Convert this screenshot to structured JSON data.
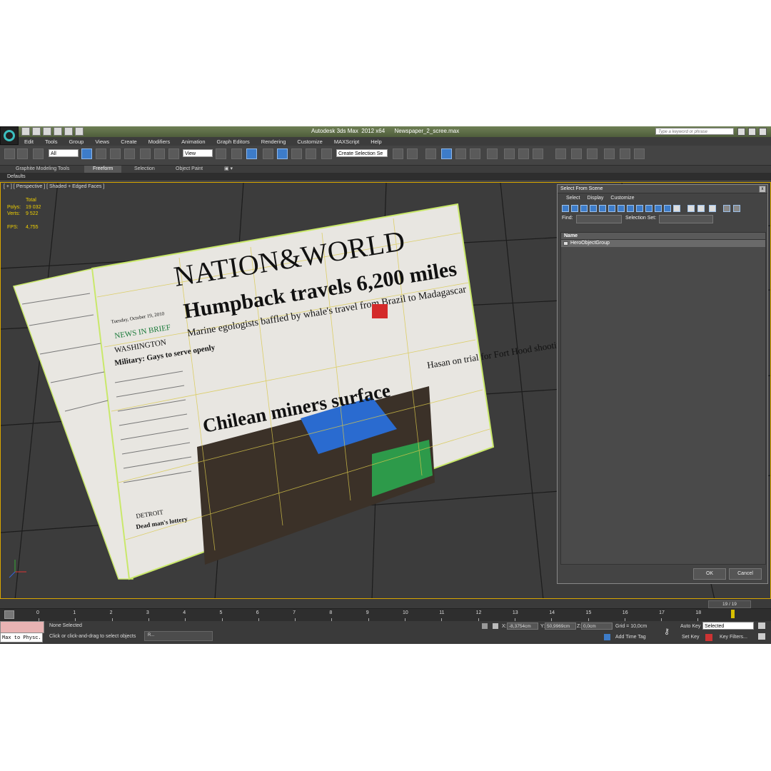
{
  "window": {
    "title": "Autodesk 3ds Max  2012 x64      Newspaper_2_scree.max",
    "search_placeholder": "Type a keyword or phrase"
  },
  "menu": [
    "Edit",
    "Tools",
    "Group",
    "Views",
    "Create",
    "Modifiers",
    "Animation",
    "Graph Editors",
    "Rendering",
    "Customize",
    "MAXScript",
    "Help"
  ],
  "toolbar": {
    "filter_value": "All",
    "ref_coord_value": "View",
    "selection_set_value": "Create Selection Se"
  },
  "ribbon": {
    "tabs": [
      "Graphite Modeling Tools",
      "Freeform",
      "Selection",
      "Object Paint"
    ],
    "active_tab": "Freeform",
    "defaults_label": "Defaults"
  },
  "viewport": {
    "label": "[ + ] [ Perspective ] [ Shaded + Edged Faces ]",
    "stats": {
      "total_label": "Total",
      "polys_label": "Polys:",
      "polys_value": "19 032",
      "verts_label": "Verts:",
      "verts_value": "9 522",
      "fps_label": "FPS:",
      "fps_value": "4,755"
    }
  },
  "newspaper": {
    "masthead": "NATION&WORLD",
    "headline": "Humpback travels 6,200 miles",
    "subhead": "Marine egologists baffled by whale's travel from Brazil to Madagascar",
    "date": "Tuesday, October 19, 2010",
    "news_in_brief": "NEWS IN BRIEF",
    "washington": "WASHINGTON",
    "brief_head": "Military: Gays to serve openly",
    "story2": "Chilean miners surface",
    "story3": "Hasan on trial for Fort Hood shooting",
    "detroit": "DETROIT",
    "lottery": "Dead man's lottery"
  },
  "dialog": {
    "title": "Select From Scene",
    "close": "x",
    "menu": [
      "Select",
      "Display",
      "Customize"
    ],
    "find_label": "Find:",
    "selection_set_label": "Selection Set:",
    "column_name": "Name",
    "items": [
      "HeroObjectGroup"
    ],
    "ok": "OK",
    "cancel": "Cancel"
  },
  "timeline": {
    "slider": "19 / 19",
    "ticks": [
      "0",
      "1",
      "2",
      "3",
      "4",
      "5",
      "6",
      "7",
      "8",
      "9",
      "10",
      "11",
      "12",
      "13",
      "14",
      "15",
      "16",
      "17",
      "18"
    ]
  },
  "status": {
    "max_to_phys": "Max to Physc.",
    "selection": "None Selected",
    "prompt": "Click or click-and-drag to select objects",
    "script_tab": "R...",
    "x_label": "X:",
    "x_value": "-8,3754cm",
    "y_label": "Y:",
    "y_value": "50,9969cm",
    "z_label": "Z:",
    "z_value": "0,0cm",
    "grid": "Grid = 10,0cm",
    "add_time_tag": "Add Time Tag",
    "auto_key": "Auto Key",
    "auto_key_value": "Selected",
    "set_key": "Set Key",
    "key_filters": "Key Filters..."
  },
  "colors": {
    "accent_blue": "#3d7cc9",
    "viewport_border": "#d8a600",
    "stats_yellow": "#f0d000",
    "wire_green": "#b6e05a"
  }
}
